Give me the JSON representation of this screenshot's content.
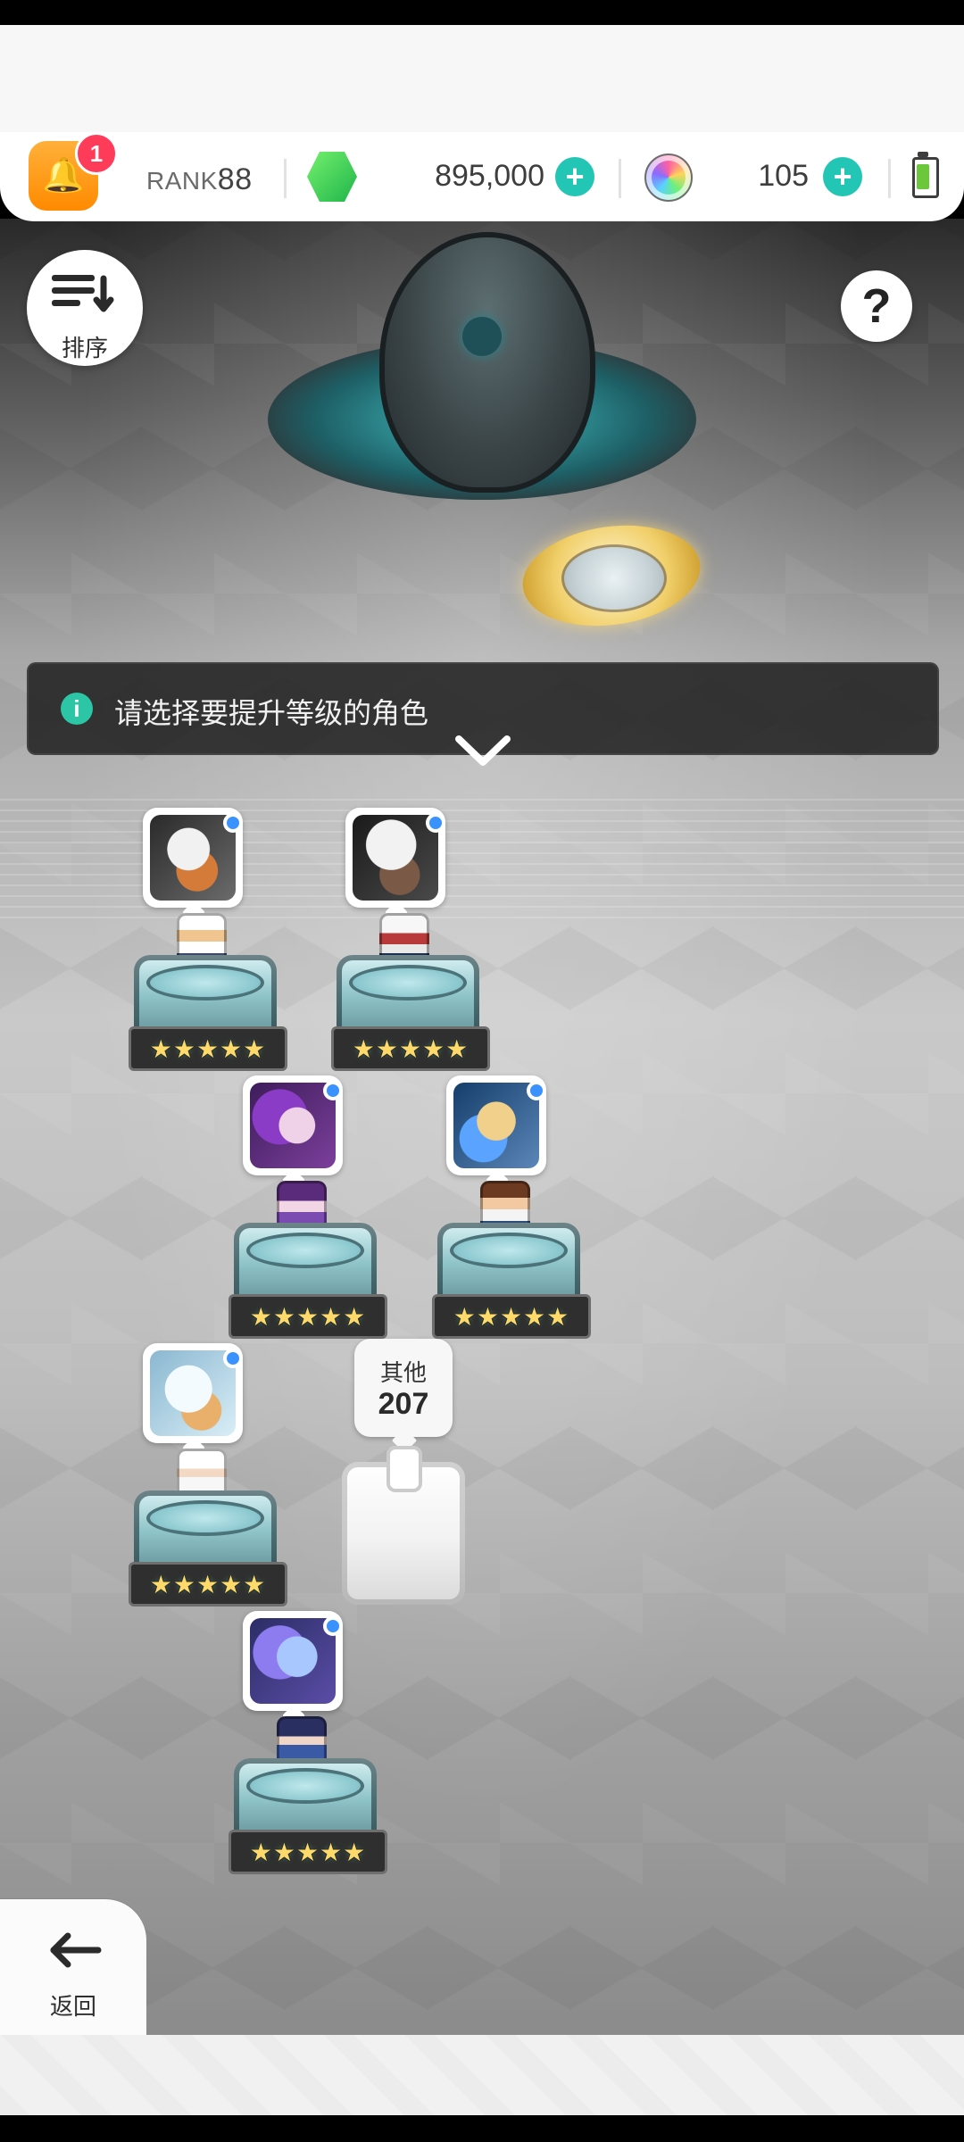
{
  "topbar": {
    "notifications": {
      "badge_count": "1",
      "icon": "bell-icon"
    },
    "rank": {
      "label": "RANK",
      "value": "88"
    },
    "gems": {
      "icon": "green-gem-icon",
      "amount": "895,000",
      "plus_icon": "plus-icon"
    },
    "rainbow": {
      "icon": "rainbow-orb-icon",
      "amount": "105",
      "plus_icon": "plus-icon"
    },
    "battery": {
      "icon": "battery-icon",
      "level": 0.7,
      "color": "#6ac83a"
    }
  },
  "controls": {
    "sort": {
      "label": "排序",
      "icon": "sort-icon"
    },
    "help": {
      "label": "?",
      "icon": "help-icon"
    }
  },
  "banner": {
    "text": "请选择要提升等级的角色",
    "icon": "info-icon",
    "chevron": "chevron-down-icon"
  },
  "characters": {
    "items": [
      {
        "name": "character-1",
        "stars": "★★★★★",
        "portrait_colors": [
          "#2a2a2a",
          "#f1f1f1",
          "#d47b3a"
        ]
      },
      {
        "name": "character-2",
        "stars": "★★★★★",
        "portrait_colors": [
          "#1a1a1a",
          "#f2f2f2",
          "#7a5a46"
        ]
      },
      {
        "name": "character-3",
        "stars": "★★★★★",
        "portrait_colors": [
          "#3d1d5a",
          "#8b3cc6",
          "#f0d2e8"
        ]
      },
      {
        "name": "character-4",
        "stars": "★★★★★",
        "portrait_colors": [
          "#153e6b",
          "#5aa3ff",
          "#f0d08a"
        ]
      },
      {
        "name": "character-5",
        "stars": "★★★★★",
        "portrait_colors": [
          "#8ab7d0",
          "#f4fbff",
          "#e8b06a"
        ]
      },
      {
        "name": "character-6",
        "stars": "★★★★★",
        "portrait_colors": [
          "#2b2d66",
          "#8d7bf0",
          "#a8c6ff"
        ]
      }
    ],
    "other": {
      "label": "其他",
      "count": "207"
    }
  },
  "footer": {
    "back": {
      "label": "返回",
      "icon": "back-arrow-icon"
    }
  }
}
